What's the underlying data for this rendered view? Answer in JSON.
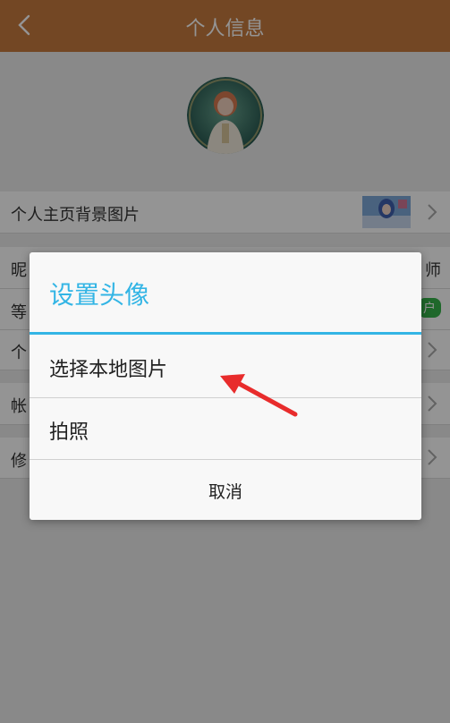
{
  "header": {
    "title": "个人信息"
  },
  "rows": [
    {
      "label": "个人主页背景图片"
    },
    {
      "label": "昵",
      "value": "师"
    },
    {
      "label": "等",
      "badge": "户"
    },
    {
      "label": "个"
    },
    {
      "label": "帐"
    },
    {
      "label": "修"
    }
  ],
  "dialog": {
    "title": "设置头像",
    "options": [
      {
        "label": "选择本地图片"
      },
      {
        "label": "拍照"
      }
    ],
    "cancel": "取消"
  },
  "colors": {
    "header": "#c77a3e",
    "accent": "#33b5e5",
    "badge": "#36b34a",
    "arrow": "#e82c2c"
  },
  "icons": [
    "back-arrow-icon",
    "chevron-right-icon",
    "avatar-image",
    "background-thumbnail",
    "annotation-arrow"
  ]
}
